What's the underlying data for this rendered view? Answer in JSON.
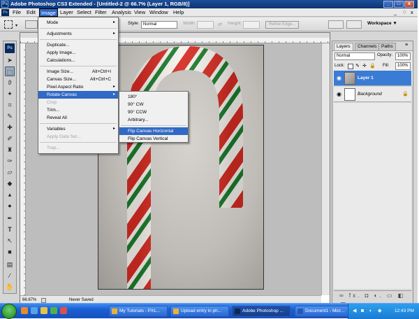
{
  "window": {
    "title": "Adobe Photoshop CS3 Extended - [Untitled-2 @ 66.7% (Layer 1, RGB/8)]",
    "app_badge": "Ps",
    "controls": [
      "_",
      "□",
      "x"
    ]
  },
  "menubar": {
    "items": [
      "File",
      "Edit",
      "Image",
      "Layer",
      "Select",
      "Filter",
      "Analysis",
      "View",
      "Window",
      "Help"
    ],
    "doc_controls": [
      "_",
      "♢",
      "x"
    ]
  },
  "options": {
    "style_label": "Style:",
    "style_value": "Normal",
    "width_label": "Width:",
    "height_label": "Height:",
    "refine_edge": "Refine Edge...",
    "workspace": "Workspace ▼"
  },
  "status": {
    "zoom": "66.67%",
    "doc_info": "Never Saved"
  },
  "image_menu": [
    {
      "label": "Mode",
      "arrow": "▸"
    },
    {
      "sep": true
    },
    {
      "label": "Adjustments",
      "arrow": "▸"
    },
    {
      "sep": true
    },
    {
      "label": "Duplicate..."
    },
    {
      "label": "Apply Image..."
    },
    {
      "label": "Calculations..."
    },
    {
      "sep": true
    },
    {
      "label": "Image Size...",
      "shortcut": "Alt+Ctrl+I"
    },
    {
      "label": "Canvas Size...",
      "shortcut": "Alt+Ctrl+C"
    },
    {
      "label": "Pixel Aspect Ratio",
      "arrow": "▸"
    },
    {
      "label": "Rotate Canvas",
      "arrow": "▸",
      "highlight": true
    },
    {
      "label": "Crop",
      "disabled": true
    },
    {
      "label": "Trim..."
    },
    {
      "label": "Reveal All"
    },
    {
      "sep": true
    },
    {
      "label": "Variables",
      "arrow": "▸"
    },
    {
      "label": "Apply Data Set...",
      "disabled": true
    },
    {
      "sep": true
    },
    {
      "label": "Trap...",
      "disabled": true
    }
  ],
  "rotate_submenu": [
    {
      "label": "180°"
    },
    {
      "label": "90° CW"
    },
    {
      "label": "90° CCW"
    },
    {
      "label": "Arbitrary..."
    },
    {
      "sep": true
    },
    {
      "label": "Flip Canvas Horizontal",
      "highlight": true
    },
    {
      "label": "Flip Canvas Vertical"
    }
  ],
  "layers_panel": {
    "tabs": [
      "Layers",
      "Channels",
      "Paths"
    ],
    "blend_mode": "Normal",
    "opacity_label": "Opacity:",
    "opacity_value": "100%",
    "lock_label": "Lock:",
    "fill_label": "Fill:",
    "fill_value": "100%",
    "layers": [
      {
        "name": "Layer 1",
        "selected": true
      },
      {
        "name": "Background",
        "selected": false
      }
    ],
    "footer_icons": "∞ fx. ◘ ◐. ▭ ◧ 🗑"
  },
  "taskbar": {
    "items": [
      {
        "label": "My Tutorials - PXL...",
        "color": "#e8b23a"
      },
      {
        "label": "Upload entry in ph...",
        "color": "#e8b23a"
      },
      {
        "label": "Adobe Photoshop ...",
        "color": "#0b2a5c",
        "active": true
      },
      {
        "label": "Document1 - Micr...",
        "color": "#2a57b3"
      }
    ],
    "time": "12:43 PM"
  },
  "colors": {
    "menu_highlight": "#3169c6",
    "candy_red": "#d42b22",
    "candy_green": "#1c7a2c"
  }
}
